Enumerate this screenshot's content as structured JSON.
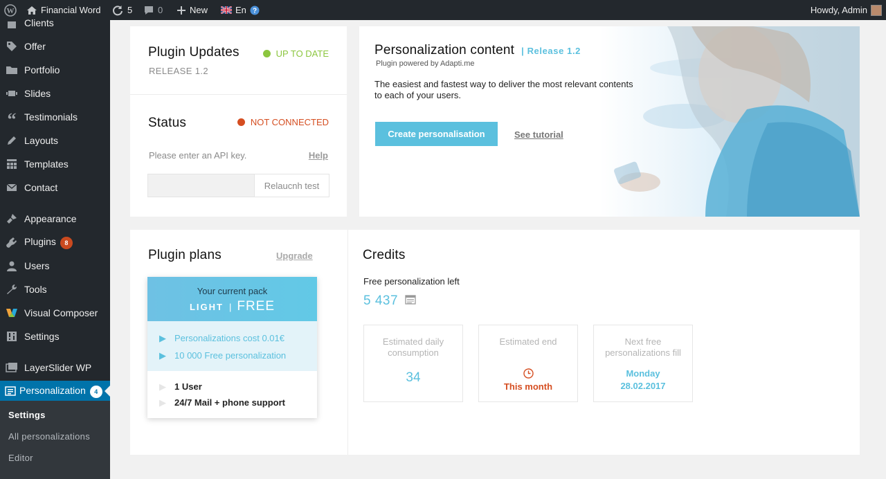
{
  "colors": {
    "wp_dark": "#23282d",
    "wp_blue": "#0073aa",
    "accent_blue": "#5bc0de",
    "green": "#8cc63f",
    "orange": "#d54e21"
  },
  "adminbar": {
    "site_name": "Financial Word",
    "updates_count": "5",
    "comments_count": "0",
    "new_label": "New",
    "lang_label": "En",
    "howdy": "Howdy, Admin"
  },
  "sidebar": {
    "items": [
      {
        "label": "Clients",
        "icon": "clients-icon"
      },
      {
        "label": "Offer",
        "icon": "tag-icon"
      },
      {
        "label": "Portfolio",
        "icon": "folder-icon"
      },
      {
        "label": "Slides",
        "icon": "slides-icon"
      },
      {
        "label": "Testimonials",
        "icon": "quote-icon"
      },
      {
        "label": "Layouts",
        "icon": "pencil-icon"
      },
      {
        "label": "Templates",
        "icon": "grid-icon"
      },
      {
        "label": "Contact",
        "icon": "mail-icon"
      },
      {
        "label": "Appearance",
        "icon": "brush-icon"
      },
      {
        "label": "Plugins",
        "icon": "plug-icon",
        "badge": "8"
      },
      {
        "label": "Users",
        "icon": "user-icon"
      },
      {
        "label": "Tools",
        "icon": "wrench-icon"
      },
      {
        "label": "Visual Composer",
        "icon": "vc-icon"
      },
      {
        "label": "Settings",
        "icon": "settings-icon"
      },
      {
        "label": "LayerSlider WP",
        "icon": "layers-icon"
      },
      {
        "label": "Personalization",
        "icon": "personalization-icon",
        "badge": "4"
      }
    ],
    "submenu": [
      "Settings",
      "All personalizations",
      "Editor"
    ]
  },
  "updates": {
    "title": "Plugin Updates",
    "status": "UP TO DATE",
    "release": "RELEASE 1.2"
  },
  "status": {
    "title": "Status",
    "state": "NOT CONNECTED",
    "hint": "Please enter an API key.",
    "help": "Help",
    "api_key_value": "",
    "test_button": "Relaucnh test"
  },
  "hero": {
    "title": "Personalization content",
    "release": "| Release 1.2",
    "powered": "Plugin powered by Adapti.me",
    "desc_line1": "The easiest and fastest way to deliver the most relevant contents",
    "desc_line2": "to each of your users.",
    "cta": "Create personalisation",
    "tutorial": "See tutorial"
  },
  "plans": {
    "title": "Plugin plans",
    "upgrade": "Upgrade",
    "pack_label": "Your current pack",
    "pack_name": "LIGHT",
    "pack_sep": "|",
    "pack_price": "FREE",
    "features_highlight": [
      "Personalizations cost 0.01€",
      "10 000 Free personalization"
    ],
    "features": [
      "1 User",
      "24/7 Mail + phone support"
    ]
  },
  "credits": {
    "title": "Credits",
    "left_label": "Free personalization left",
    "left_value": "5 437",
    "boxes": [
      {
        "title_line1": "Estimated daily",
        "title_line2": "consumption",
        "value": "34"
      },
      {
        "title_line1": "Estimated end",
        "title_line2": "",
        "value": "This month"
      },
      {
        "title_line1": "Next free",
        "title_line2": "personalizations fill",
        "value_line1": "Monday",
        "value_line2": "28.02.2017"
      }
    ]
  }
}
